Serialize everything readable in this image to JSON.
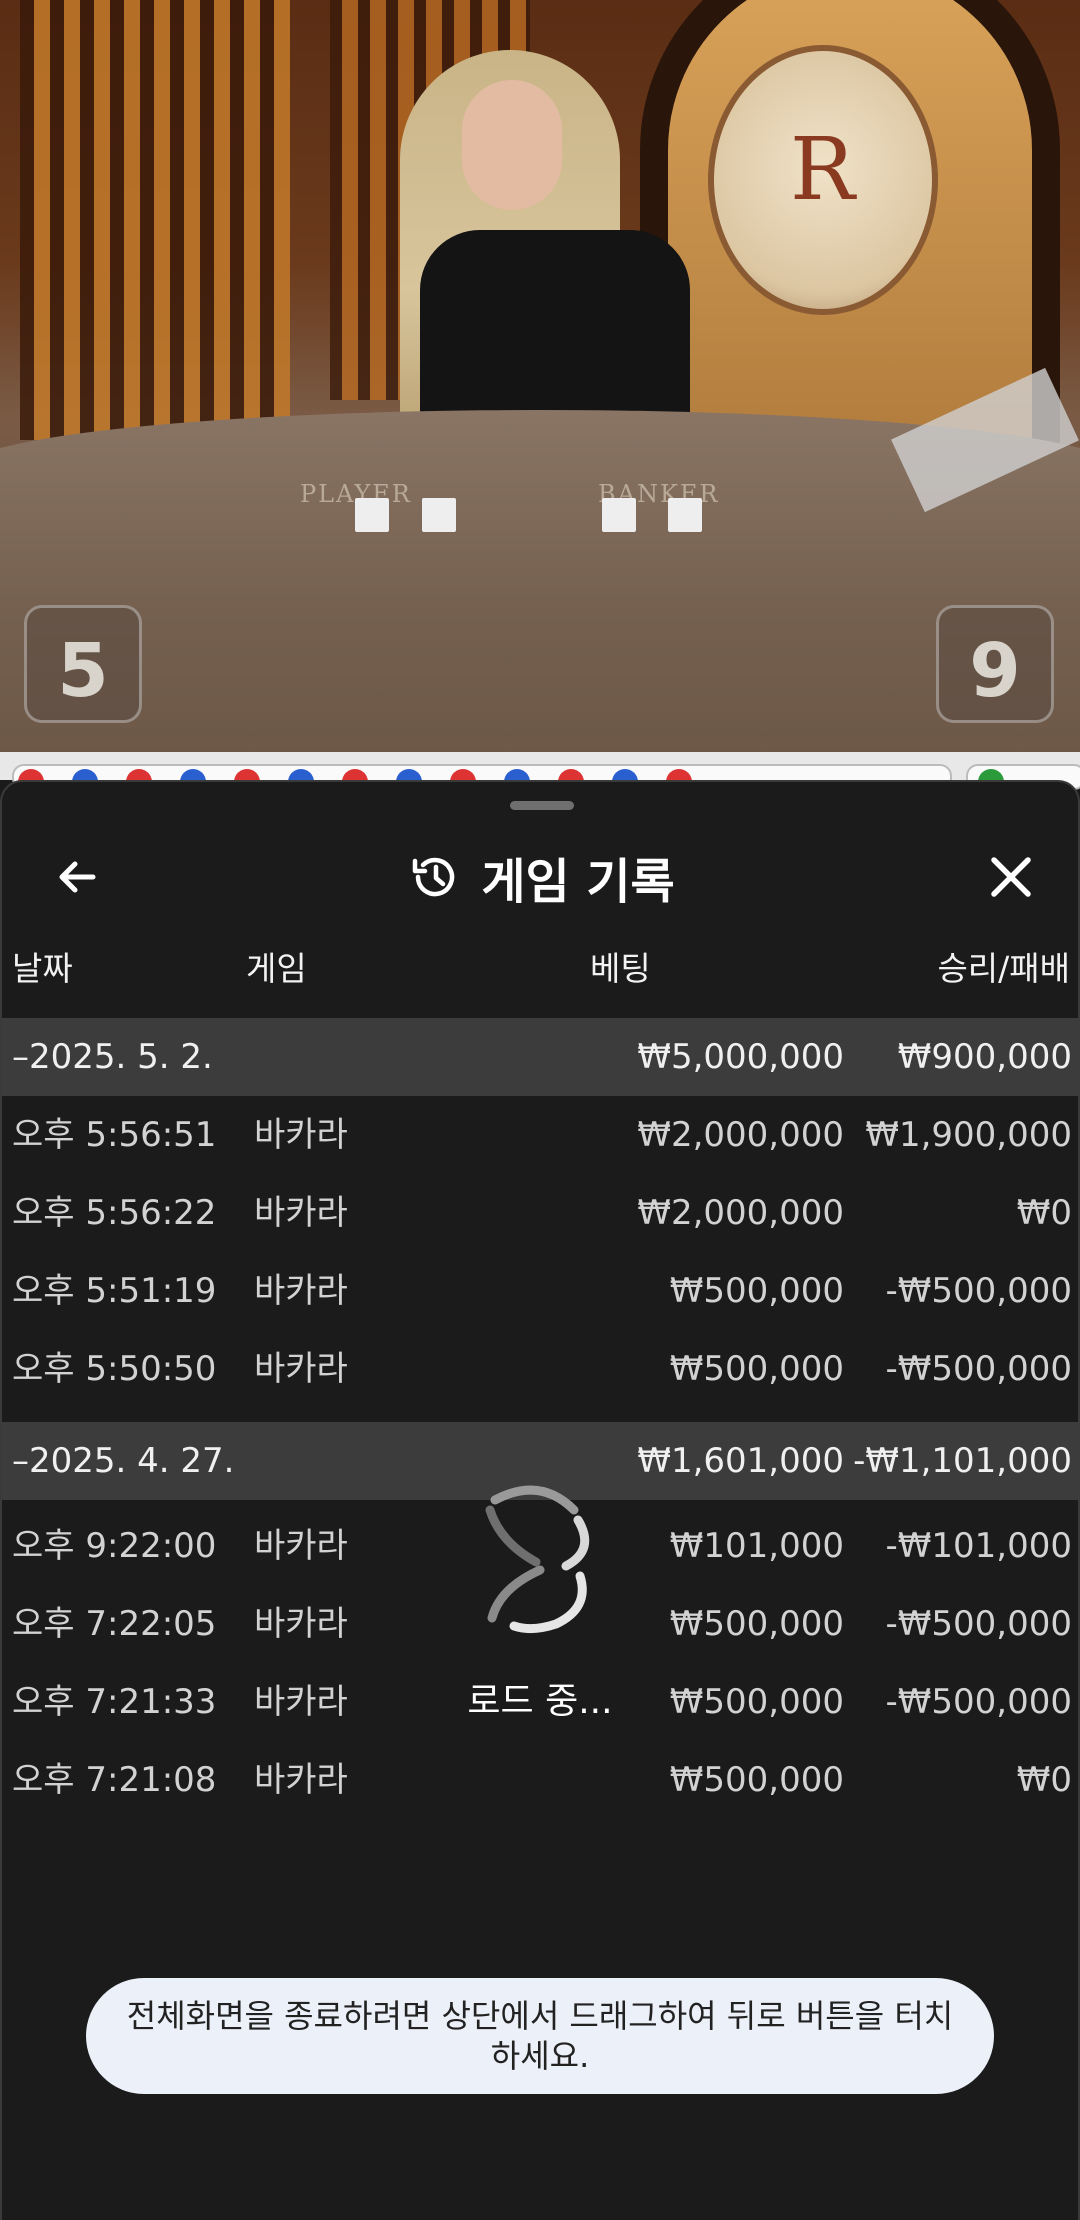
{
  "video": {
    "table_labels": {
      "player": "PLAYER",
      "banker": "BANKER"
    },
    "player_score": "5",
    "banker_score": "9"
  },
  "sheet": {
    "title": "게임 기록",
    "icons": {
      "back": "arrow-left-icon",
      "history": "history-icon",
      "close": "close-icon"
    },
    "columns": {
      "date": "날짜",
      "game": "게임",
      "bet": "베팅",
      "winloss": "승리/패배"
    }
  },
  "history": [
    {
      "date": "–2025. 5. 2.",
      "bet": "₩5,000,000",
      "winloss": "₩900,000",
      "rows": [
        {
          "time": "오후 5:56:51",
          "game": "바카라",
          "bet": "₩2,000,000",
          "winloss": "₩1,900,000"
        },
        {
          "time": "오후 5:56:22",
          "game": "바카라",
          "bet": "₩2,000,000",
          "winloss": "₩0"
        },
        {
          "time": "오후 5:51:19",
          "game": "바카라",
          "bet": "₩500,000",
          "winloss": "-₩500,000"
        },
        {
          "time": "오후 5:50:50",
          "game": "바카라",
          "bet": "₩500,000",
          "winloss": "-₩500,000"
        }
      ]
    },
    {
      "date": "–2025. 4. 27.",
      "bet": "₩1,601,000",
      "winloss": "-₩1,101,000",
      "rows": [
        {
          "time": "오후 9:22:00",
          "game": "바카라",
          "bet": "₩101,000",
          "winloss": "-₩101,000"
        },
        {
          "time": "오후 7:22:05",
          "game": "바카라",
          "bet": "₩500,000",
          "winloss": "-₩500,000"
        },
        {
          "time": "오후 7:21:33",
          "game": "바카라",
          "bet": "₩500,000",
          "winloss": "-₩500,000"
        },
        {
          "time": "오후 7:21:08",
          "game": "바카라",
          "bet": "₩500,000",
          "winloss": "₩0"
        }
      ]
    }
  ],
  "loader": {
    "text": "로드 중...",
    "icon": "spinner-icon"
  },
  "toast": {
    "text": "전체화면을 종료하려면 상단에서 드래그하여 뒤로 버튼을 터치하세요."
  },
  "colors": {
    "sheet_bg": "#1b1b1b",
    "group_row_bg": "#3c3c3c",
    "toast_bg": "#ecf0f8"
  }
}
